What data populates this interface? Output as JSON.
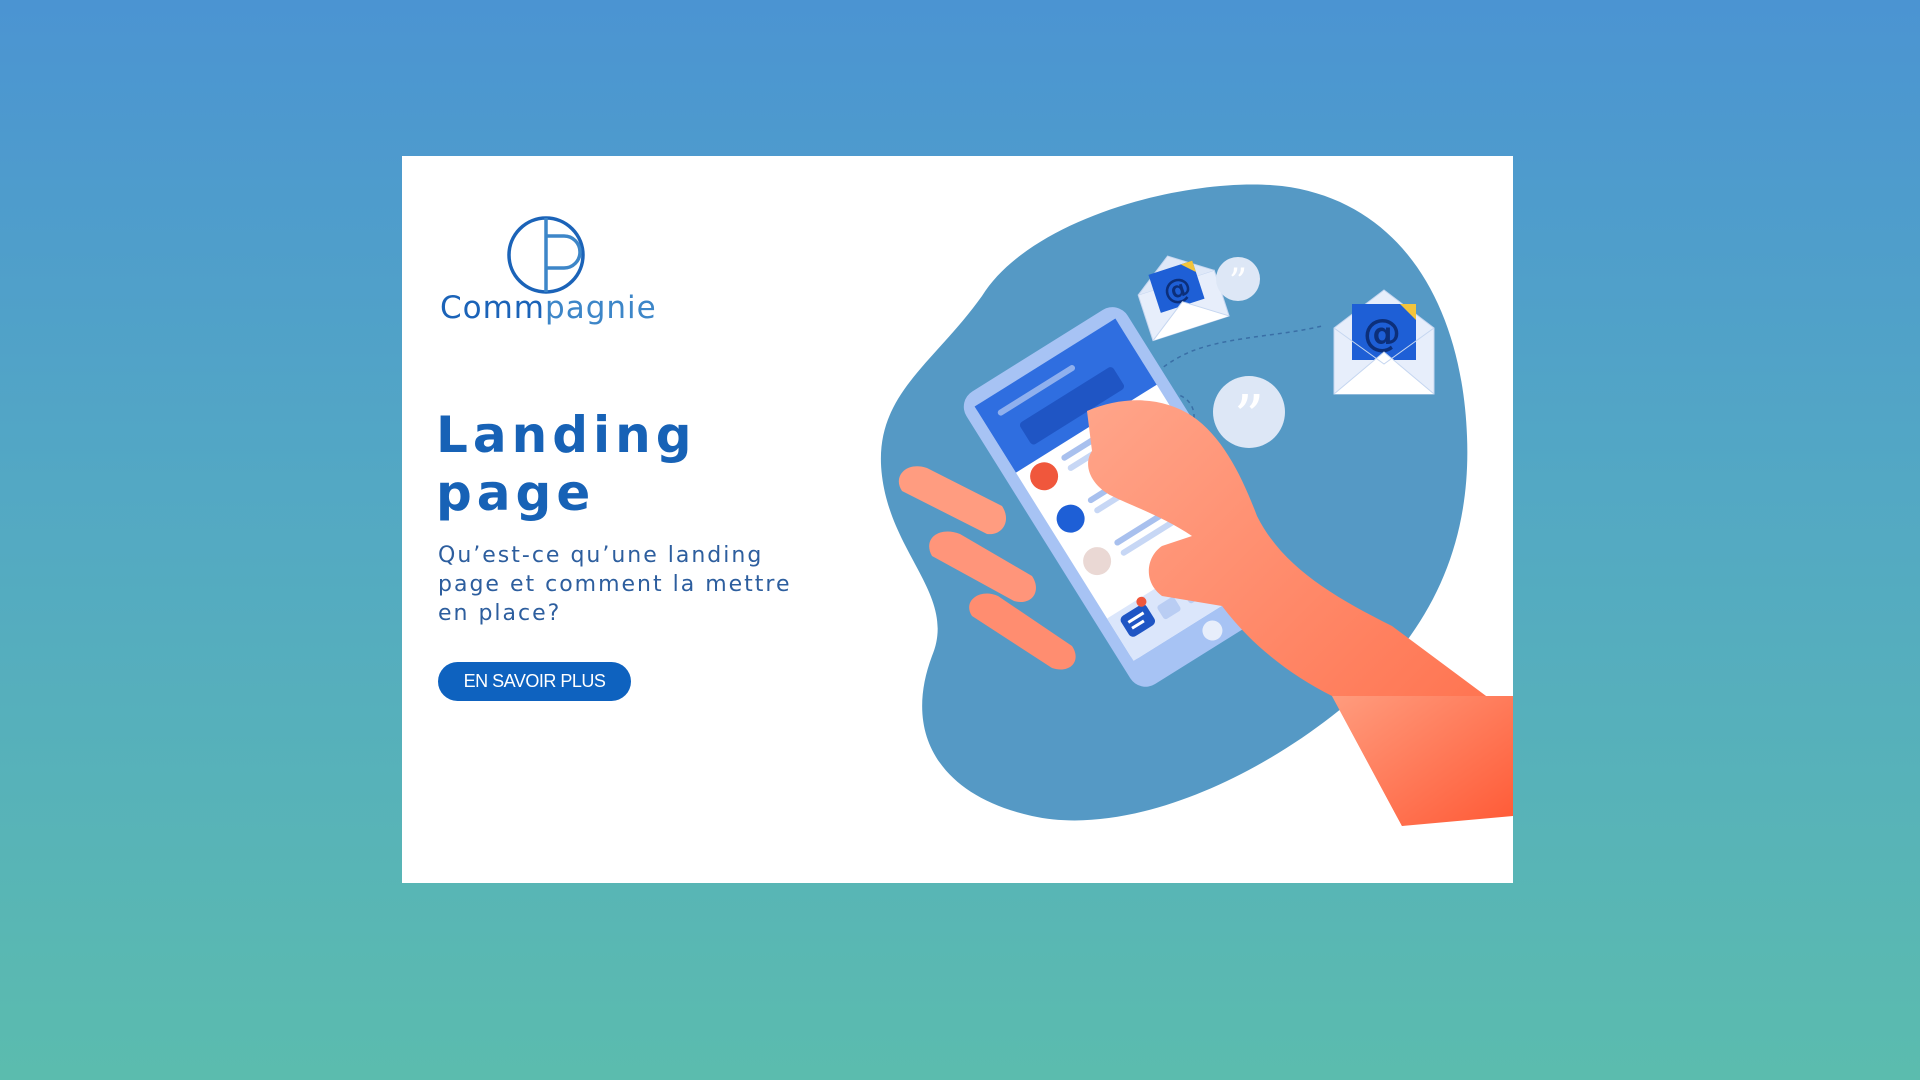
{
  "brand": {
    "logo_initials": "CP",
    "name_part1": "Comm",
    "name_part2": "pagnie"
  },
  "hero": {
    "title_line1": "Landing",
    "title_line2": "page",
    "subtitle": "Qu’est-ce qu’une landing page et comment la mettre en place?",
    "cta_label": "EN SAVOIR PLUS"
  },
  "colors": {
    "background_top": "#4b94d2",
    "background_bottom": "#5bbcae",
    "brand_blue": "#1762b6",
    "button_blue": "#0e62bf",
    "blob": "#5599c5",
    "hand": "#ff8a6b"
  },
  "illustration": {
    "icons": [
      "email-at-icon",
      "email-at-icon",
      "quote-bubble-icon",
      "quote-bubble-icon",
      "phone-icon",
      "hand-icon",
      "chat-icon"
    ]
  }
}
